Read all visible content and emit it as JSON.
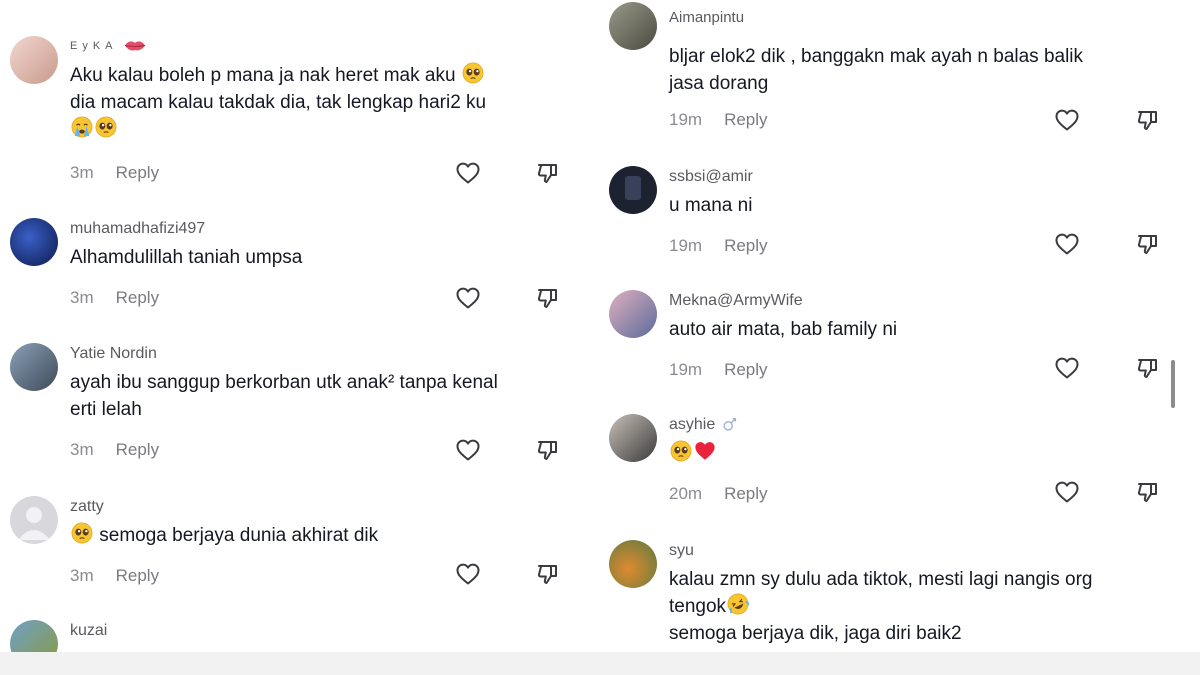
{
  "left_comments": [
    {
      "username": "EyKA",
      "lines": [
        "Aku kalau boleh p mana ja nak heret mak aku",
        "dia macam kalau takdak dia, tak lengkap hari2 ku",
        ""
      ],
      "time": "3m",
      "reply": "Reply"
    },
    {
      "username": "muhamadhafizi497",
      "lines": [
        "Alhamdulillah taniah umpsa"
      ],
      "time": "3m",
      "reply": "Reply"
    },
    {
      "username": "Yatie Nordin",
      "lines": [
        "ayah ibu sanggup berkorban utk anak² tanpa kenal",
        "erti lelah"
      ],
      "time": "3m",
      "reply": "Reply"
    },
    {
      "username": "zatty",
      "lines": [
        "semoga berjaya dunia akhirat dik"
      ],
      "time": "3m",
      "reply": "Reply"
    },
    {
      "username": "kuzai",
      "lines": [],
      "time": "",
      "reply": ""
    }
  ],
  "right_comments": [
    {
      "username": "Aimanpintu",
      "lines": [
        "bljar elok2 dik , banggakn mak ayah n balas balik",
        "jasa dorang"
      ],
      "time": "19m",
      "reply": "Reply"
    },
    {
      "username": "ssbsi@amir",
      "lines": [
        "u mana ni"
      ],
      "time": "19m",
      "reply": "Reply"
    },
    {
      "username": "Mekna@ArmyWife",
      "lines": [
        "auto air mata, bab family ni"
      ],
      "time": "19m",
      "reply": "Reply"
    },
    {
      "username": "asyhie",
      "lines": [
        ""
      ],
      "time": "20m",
      "reply": "Reply"
    },
    {
      "username": "syu",
      "lines": [
        "kalau zmn sy dulu ada tiktok, mesti lagi nangis org",
        "tengok",
        "semoga berjaya dik, jaga diri baik2"
      ],
      "time": "",
      "reply": ""
    }
  ],
  "colors": {
    "text": "#161823",
    "muted": "#8a8b91",
    "username": "#5a5a5f",
    "heart": "#e8233b"
  },
  "icons": [
    "heart-outline-icon",
    "dislike-icon",
    "pleading-face-emoji",
    "crying-face-emoji",
    "red-heart-emoji",
    "rofl-emoji",
    "lips-emoji",
    "gender-icon"
  ]
}
